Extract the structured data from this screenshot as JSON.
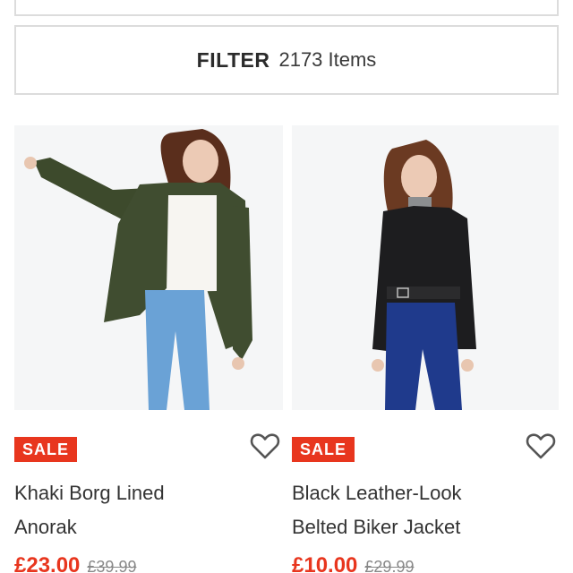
{
  "filter": {
    "label": "FILTER",
    "count": "2173 Items"
  },
  "products": [
    {
      "badge": "SALE",
      "name_line1": "Khaki Borg Lined",
      "name_line2": "Anorak",
      "price_now": "£23.00",
      "price_was": "£39.99"
    },
    {
      "badge": "SALE",
      "name_line1": "Black Leather-Look",
      "name_line2": "Belted Biker Jacket",
      "price_now": "£10.00",
      "price_was": "£29.99"
    }
  ],
  "icons": {
    "wishlist": "heart-outline-icon"
  },
  "colors": {
    "sale": "#e8361e",
    "border": "#dcdcdc",
    "text": "#333333"
  }
}
